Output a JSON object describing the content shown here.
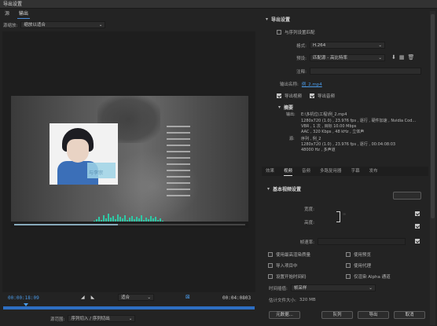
{
  "window": {
    "title": "导出设置"
  },
  "tabs": [
    {
      "label": "源",
      "active": false
    },
    {
      "label": "输出",
      "active": true
    }
  ],
  "preview": {
    "zoom_label": "源缩放:",
    "zoom_value": "缩放以适合",
    "thumbnail_badge_text": "与李宗"
  },
  "timeline": {
    "timecode_in": "00:00:18:09",
    "timecode_duration": "00:04:0803",
    "fit_value": "适合",
    "source_range_label": "源范围:",
    "source_range_value": "序列切入 / 序列切出"
  },
  "export": {
    "section_title": "导出设置",
    "match_sequence_label": "与序列设置匹配",
    "match_sequence_checked": false,
    "format_label": "格式:",
    "format_value": "H.264",
    "preset_label": "预设:",
    "preset_value": "匹配源 - 高比特率",
    "comment_label": "注释:",
    "comment_value": "",
    "output_name_label": "输出名称:",
    "output_name_value": "例_2.mp4",
    "export_video_label": "导出视频",
    "export_video_checked": true,
    "export_audio_label": "导出音频",
    "export_audio_checked": true
  },
  "summary": {
    "title": "摘要",
    "output_label": "输出:",
    "output_lines": [
      "E:\\多机位\\工程\\例_2.mp4",
      "1280x720 (1.0) , 23.976 fps , 逐行 , 硬件加速 , Nvidia Cod…",
      "VBR , 1 次 , 目标 10.00 Mbps",
      "AAC , 320 Kbps , 48 kHz , 立体声"
    ],
    "source_label": "源:",
    "source_lines": [
      "序列 , 例_2",
      "1280x720 (1.0) , 23.976 fps , 逐行 , 00:04:08:03",
      "48000 Hz , 多声道"
    ]
  },
  "settings_tabs": [
    {
      "label": "效果",
      "active": false
    },
    {
      "label": "视频",
      "active": true
    },
    {
      "label": "音频",
      "active": false
    },
    {
      "label": "多路复用器",
      "active": false
    },
    {
      "label": "字幕",
      "active": false
    },
    {
      "label": "发布",
      "active": false
    }
  ],
  "basic_video": {
    "section_title": "基本视频设置",
    "width_label": "宽度:",
    "width_value": "",
    "height_label": "高度:",
    "height_value": "",
    "frame_rate_label": "帧速率:",
    "frame_rate_value": ""
  },
  "bottom": {
    "use_max_render_label": "使用最高渲染质量",
    "use_previews_label": "使用预览",
    "import_into_project_label": "导入项目中",
    "use_proxies_label": "使用代理",
    "set_start_timecode_label": "设置开始时间码",
    "render_alpha_label": "仅渲染 Alpha 通道",
    "time_interpolation_label": "时间插值:",
    "time_interpolation_value": "帧采样",
    "file_size_label": "估计文件大小:",
    "file_size_value": "320 MB",
    "metadata_button": "元数据...",
    "queue_button": "队列",
    "export_button": "导出",
    "cancel_button": "取消"
  },
  "colors": {
    "accent": "#4a9ae8",
    "wave": "#2ec9a6"
  }
}
